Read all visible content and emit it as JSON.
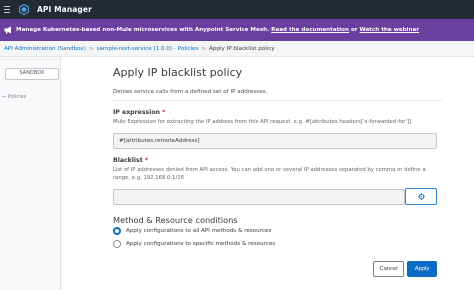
{
  "topbar": {
    "app_title": "API Manager",
    "menu_icon": "hamburger-menu-icon",
    "logo_icon": "anypoint-logo-icon"
  },
  "banner": {
    "icon": "megaphone-icon",
    "text": "Manage Kubernetes-based non-Mule microservices with Anypoint Service Mesh.",
    "link1": "Read the documentation",
    "or": "or",
    "link2": "Watch the webinar",
    "bg_color": "#6b3f9f"
  },
  "breadcrumb": {
    "items": [
      "API Administration (Sandbox)",
      "sample-rest-service (1.0.0) - Policies",
      "Apply IP blacklist policy"
    ],
    "separator": ">"
  },
  "sidebar": {
    "environment": "SANDBOX",
    "back": "← Policies"
  },
  "main": {
    "title": "Apply IP blacklist policy",
    "description": "Denies service calls from a defined set of IP addresses.",
    "ip_expression": {
      "label": "IP expression",
      "required": "*",
      "help": "Mule Expression for extracting the IP address from this API request. e.g. #[attributes.headers['x-forwarded-for']]",
      "value": "#[attributes.remoteAddress]"
    },
    "blacklist": {
      "label": "Blacklist",
      "required": "*",
      "help": "List of IP addresses denied from API access. You can add one or several IP addresses separated by comma or define a range, e.g. 192.168.0.1/16",
      "value": "",
      "add_icon": "settings-gear-icon"
    },
    "conditions": {
      "heading": "Method & Resource conditions",
      "options": [
        "Apply configurations to all API methods & resources",
        "Apply configurations to specific methods & resources"
      ],
      "selected_index": 0
    },
    "buttons": {
      "cancel": "Cancel",
      "apply": "Apply"
    },
    "accent_color": "#0b6cc3"
  }
}
